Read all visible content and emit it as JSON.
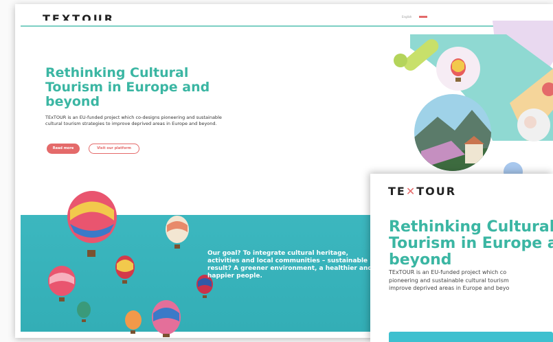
{
  "header": {
    "logo_text": "TEXTOUR",
    "language_label": "English",
    "colors": {
      "rule": "#7ccfc3"
    }
  },
  "hero": {
    "title": "Rethinking Cultural Tourism in Europe and beyond",
    "description": "TExTOUR is an EU-funded project which co-designs pioneering and sustainable cultural tourism strategies to improve deprived areas in Europe and beyond.",
    "read_more_label": "Read more",
    "platform_label": "Visit our platform",
    "colors": {
      "title": "#3bb6a3",
      "button": "#e46a6a"
    }
  },
  "banner": {
    "goal_text": "Our goal? To integrate cultural heritage, activities and local communities – sustainable result? A greener environment, a healthier and happier people.",
    "colors": {
      "background": "#3cb7bf"
    }
  },
  "mobile_preview": {
    "logo_prefix": "TE",
    "logo_mark": "✕",
    "logo_suffix": "TOUR",
    "title_lines": [
      "Rethinking Cultural",
      "Tourism in Europe a",
      "beyond"
    ],
    "text_lines": [
      "TExTOUR is an EU-funded project which co",
      "pioneering and sustainable cultural tourism",
      "improve deprived areas in Europe and beyo"
    ]
  },
  "icons": [
    "hot-air-balloon-icon",
    "language-flag-icon"
  ]
}
